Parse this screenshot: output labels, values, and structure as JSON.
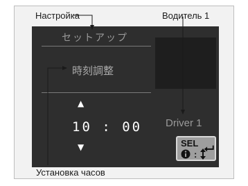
{
  "callouts": {
    "settings": "Настройка",
    "driver": "Водитель 1",
    "clock_setup": "Установка часов"
  },
  "screen": {
    "title": "セットアップ",
    "menu_item": "時刻調整",
    "time": "10 : 00",
    "driver_label": "Driver 1",
    "sel_label": "SEL :",
    "info_label": ":"
  },
  "icons": {
    "up": "up-arrow-icon",
    "down": "down-arrow-icon",
    "enter": "enter-icon",
    "info": "info-icon",
    "updown": "up-down-icon"
  }
}
